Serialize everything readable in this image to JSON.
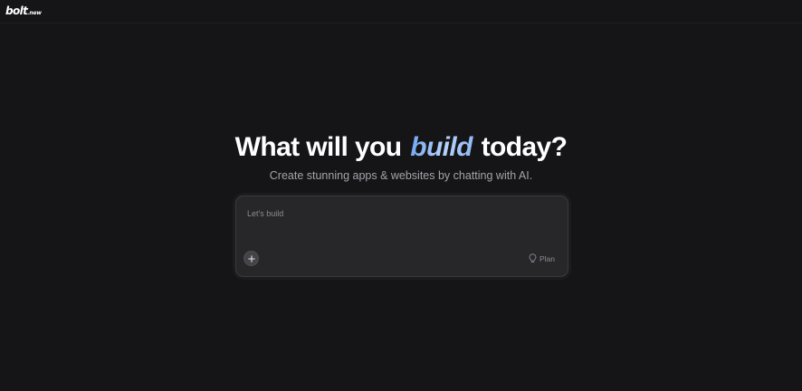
{
  "brand": {
    "logo_main": "bolt",
    "logo_tld": ".new"
  },
  "hero": {
    "headline_before": "What will you ",
    "headline_accent": "build",
    "headline_after": " today?",
    "subheadline": "Create stunning apps & websites by chatting with AI."
  },
  "prompt": {
    "placeholder": "Let's build",
    "value": "",
    "add_icon": "plus-icon",
    "plan_icon": "lightbulb-icon",
    "plan_label": "Plan"
  },
  "colors": {
    "background": "#151517",
    "accent": "#8fb8f5",
    "input_bg": "#27272a",
    "muted_text": "#8b8b93"
  }
}
